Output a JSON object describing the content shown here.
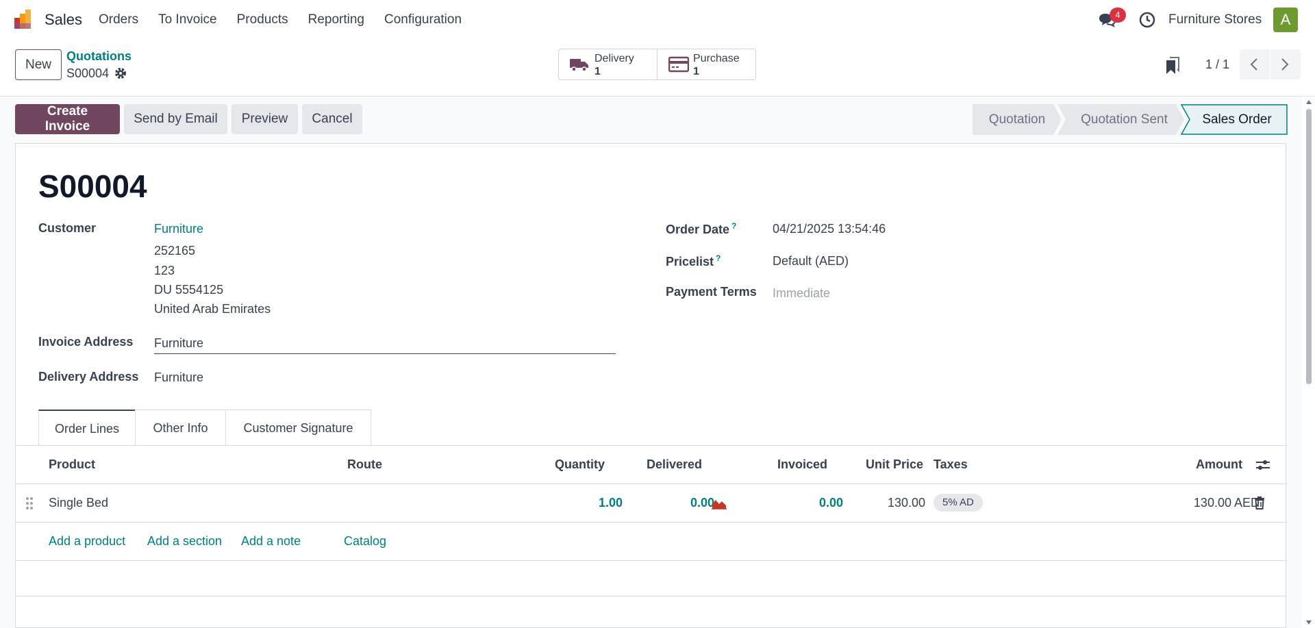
{
  "navbar": {
    "app_name": "Sales",
    "menu": [
      "Orders",
      "To Invoice",
      "Products",
      "Reporting",
      "Configuration"
    ],
    "chat_badge": "4",
    "company": "Furniture Stores",
    "avatar_letter": "A"
  },
  "control": {
    "new_label": "New",
    "breadcrumb_parent": "Quotations",
    "breadcrumb_current": "S00004",
    "smart_buttons": [
      {
        "label": "Delivery",
        "value": "1",
        "icon": "truck-icon"
      },
      {
        "label": "Purchase",
        "value": "1",
        "icon": "credit-card-icon"
      }
    ],
    "pager": "1 / 1"
  },
  "actions": {
    "create_invoice": "Create Invoice",
    "send_email": "Send by Email",
    "preview": "Preview",
    "cancel": "Cancel"
  },
  "stages": [
    "Quotation",
    "Quotation Sent",
    "Sales Order"
  ],
  "record": {
    "name": "S00004",
    "customer_label": "Customer",
    "customer_name": "Furniture",
    "customer_address": [
      "252165",
      "123",
      "DU 5554125",
      "United Arab Emirates"
    ],
    "invoice_address_label": "Invoice Address",
    "invoice_address": "Furniture",
    "delivery_address_label": "Delivery Address",
    "delivery_address": "Furniture",
    "order_date_label": "Order Date",
    "order_date": "04/21/2025 13:54:46",
    "pricelist_label": "Pricelist",
    "pricelist": "Default (AED)",
    "payment_terms_label": "Payment Terms",
    "payment_terms": "Immediate",
    "help_mark": "?"
  },
  "tabs": [
    "Order Lines",
    "Other Info",
    "Customer Signature"
  ],
  "lines": {
    "headers": {
      "product": "Product",
      "route": "Route",
      "quantity": "Quantity",
      "delivered": "Delivered",
      "invoiced": "Invoiced",
      "unit_price": "Unit Price",
      "taxes": "Taxes",
      "amount": "Amount"
    },
    "rows": [
      {
        "product": "Single Bed",
        "quantity": "1.00",
        "delivered": "0.00",
        "invoiced": "0.00",
        "unit_price": "130.00",
        "tax": "5% AD",
        "amount": "130.00 AED"
      }
    ],
    "add_product": "Add a product",
    "add_section": "Add a section",
    "add_note": "Add a note",
    "catalog": "Catalog"
  },
  "colors": {
    "primary": "#71475f",
    "link": "#017e84",
    "badge": "#dc2f3f",
    "avatar": "#6d9b2f"
  }
}
